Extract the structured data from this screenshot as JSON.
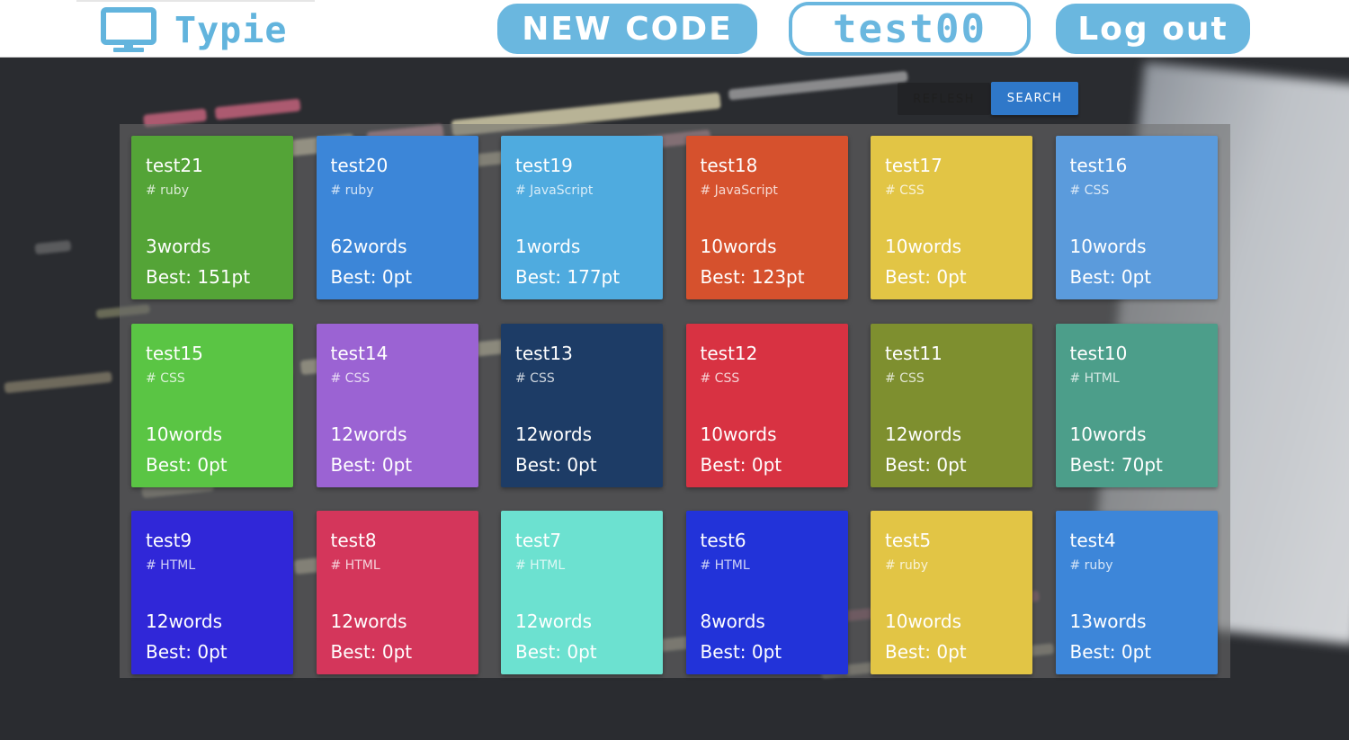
{
  "header": {
    "app_name": "Typie",
    "new_code_label": "NEW CODE",
    "username": "test00",
    "logout_label": "Log out"
  },
  "toolbar": {
    "refresh_label": "REFLESH",
    "search_label": "SEARCH"
  },
  "colors": {
    "brand": "#6ab7df",
    "search_button": "#2f78c9"
  },
  "cards": [
    {
      "title": "test21",
      "tag": "# ruby",
      "words": "3words",
      "best": "Best: 151pt",
      "color": "#54a437"
    },
    {
      "title": "test20",
      "tag": "# ruby",
      "words": "62words",
      "best": "Best: 0pt",
      "color": "#3c86d8"
    },
    {
      "title": "test19",
      "tag": "# JavaScript",
      "words": "1words",
      "best": "Best: 177pt",
      "color": "#4fabdf"
    },
    {
      "title": "test18",
      "tag": "# JavaScript",
      "words": "10words",
      "best": "Best: 123pt",
      "color": "#d6512d"
    },
    {
      "title": "test17",
      "tag": "# CSS",
      "words": "10words",
      "best": "Best: 0pt",
      "color": "#e2c545"
    },
    {
      "title": "test16",
      "tag": "# CSS",
      "words": "10words",
      "best": "Best: 0pt",
      "color": "#5b9bdc"
    },
    {
      "title": "test15",
      "tag": "# CSS",
      "words": "10words",
      "best": "Best: 0pt",
      "color": "#5ac544"
    },
    {
      "title": "test14",
      "tag": "# CSS",
      "words": "12words",
      "best": "Best: 0pt",
      "color": "#9b63d3"
    },
    {
      "title": "test13",
      "tag": "# CSS",
      "words": "12words",
      "best": "Best: 0pt",
      "color": "#1d3c66"
    },
    {
      "title": "test12",
      "tag": "# CSS",
      "words": "10words",
      "best": "Best: 0pt",
      "color": "#d83242"
    },
    {
      "title": "test11",
      "tag": "# CSS",
      "words": "12words",
      "best": "Best: 0pt",
      "color": "#7e8f2f"
    },
    {
      "title": "test10",
      "tag": "# HTML",
      "words": "10words",
      "best": "Best: 70pt",
      "color": "#4c9e8a"
    },
    {
      "title": "test9",
      "tag": "# HTML",
      "words": "12words",
      "best": "Best: 0pt",
      "color": "#3027d8"
    },
    {
      "title": "test8",
      "tag": "# HTML",
      "words": "12words",
      "best": "Best: 0pt",
      "color": "#d4365b"
    },
    {
      "title": "test7",
      "tag": "# HTML",
      "words": "12words",
      "best": "Best: 0pt",
      "color": "#6ce1d0"
    },
    {
      "title": "test6",
      "tag": "# HTML",
      "words": "8words",
      "best": "Best: 0pt",
      "color": "#2233d9"
    },
    {
      "title": "test5",
      "tag": "# ruby",
      "words": "10words",
      "best": "Best: 0pt",
      "color": "#e2c545"
    },
    {
      "title": "test4",
      "tag": "# ruby",
      "words": "13words",
      "best": "Best: 0pt",
      "color": "#3d86d9"
    }
  ]
}
